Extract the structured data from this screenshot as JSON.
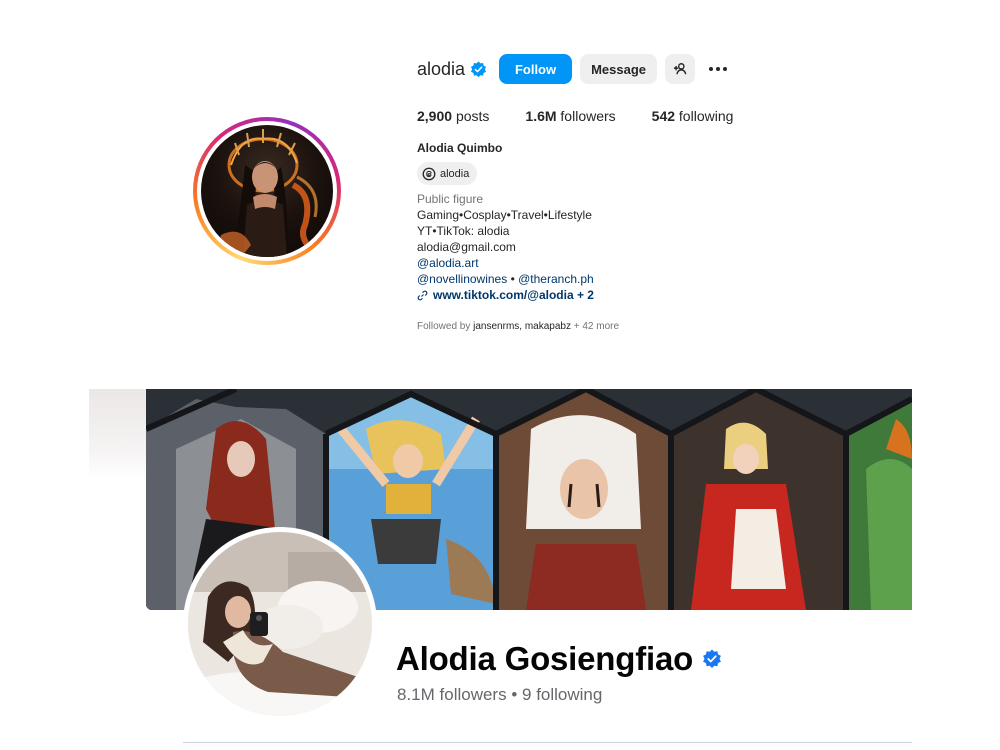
{
  "instagram": {
    "username": "alodia",
    "follow_label": "Follow",
    "message_label": "Message",
    "stats": {
      "posts_value": "2,900",
      "posts_label": "posts",
      "followers_value": "1.6M",
      "followers_label": "followers",
      "following_value": "542",
      "following_label": "following"
    },
    "full_name": "Alodia Quimbo",
    "threads_handle": "alodia",
    "bio": {
      "category": "Public figure",
      "line1": "Gaming•Cosplay•Travel•Lifestyle",
      "line2": "YT•TikTok: alodia",
      "line3": "alodia@gmail.com",
      "line4": "@alodia.art",
      "line5_a": "@novellinowines",
      "line5_sep": " • ",
      "line5_b": "@theranch.ph",
      "link": "www.tiktok.com/@alodia + 2"
    },
    "followed_by_prefix": "Followed by ",
    "followed_by_names": "jansenrms, makapabz",
    "followed_by_more": " + 42 more",
    "icons": {
      "verified": "verified-badge-icon",
      "add_person": "person-add-icon",
      "more": "more-horizontal-icon",
      "threads": "threads-icon",
      "link": "link-icon"
    },
    "colors": {
      "follow_button": "#0095f6",
      "verified": "#0095f6"
    }
  },
  "facebook": {
    "name": "Alodia Gosiengfiao",
    "followers": "8.1M followers",
    "separator": " • ",
    "following": "9 following",
    "colors": {
      "verified": "#1877f2"
    }
  }
}
